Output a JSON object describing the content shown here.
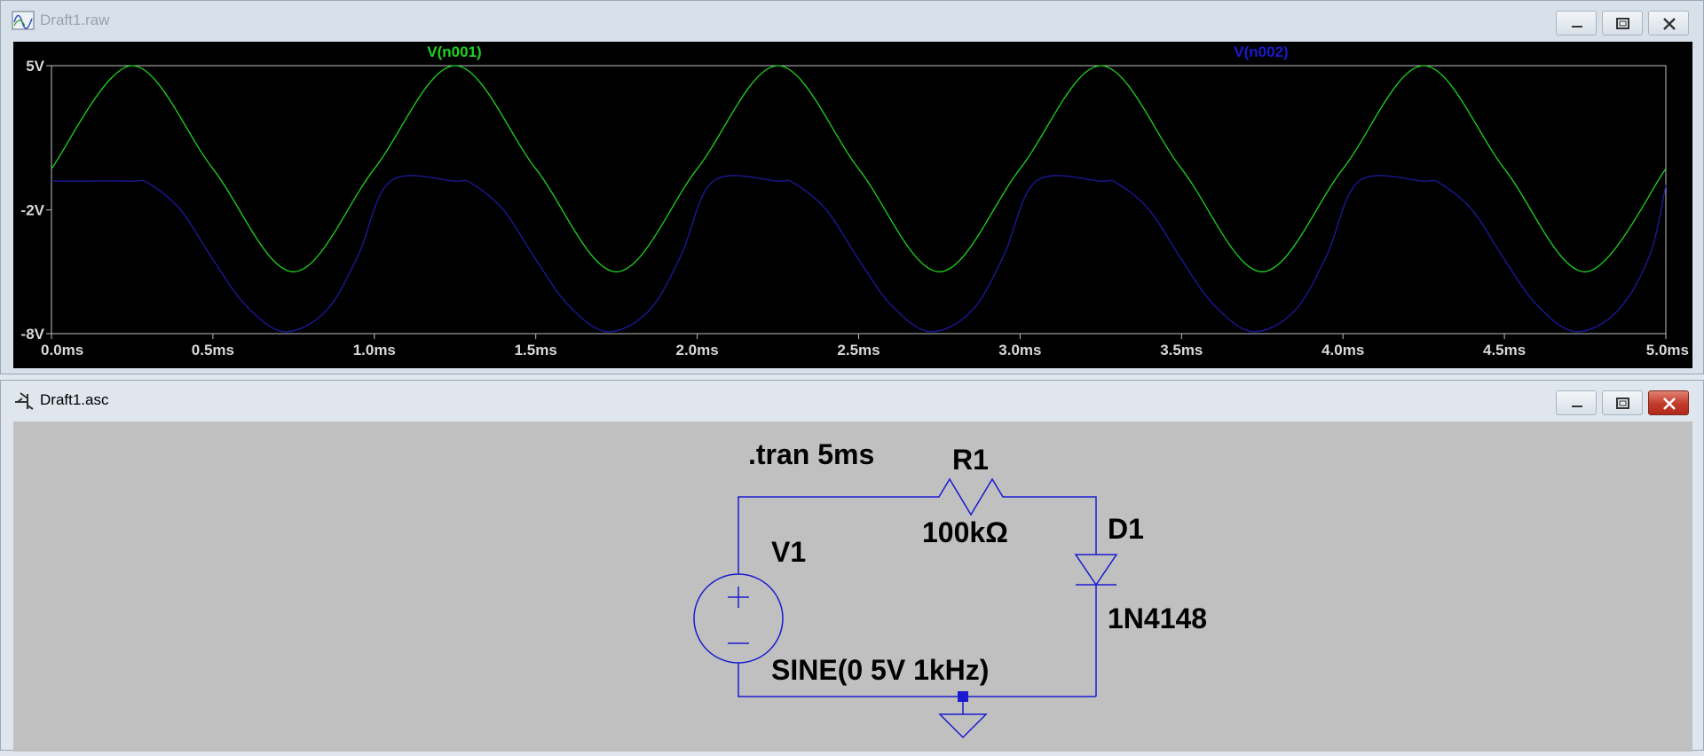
{
  "waveform_window": {
    "title": "Draft1.raw",
    "trace_labels": {
      "v_n001": "V(n001)",
      "v_n002": "V(n002)"
    },
    "y_ticks": [
      "5V",
      "-2V",
      "-8V"
    ],
    "x_ticks": [
      "0.0ms",
      "0.5ms",
      "1.0ms",
      "1.5ms",
      "2.0ms",
      "2.5ms",
      "3.0ms",
      "3.5ms",
      "4.0ms",
      "4.5ms",
      "5.0ms"
    ]
  },
  "schematic_window": {
    "title": "Draft1.asc",
    "directive": ".tran 5ms",
    "r1": {
      "name": "R1",
      "value": "100kΩ"
    },
    "v1": {
      "name": "V1",
      "value": "SINE(0 5V 1kHz)"
    },
    "d1": {
      "name": "D1",
      "value": "1N4148"
    }
  },
  "colors": {
    "v_n001": "#1ed21e",
    "v_n002": "#1a1aa0",
    "wire": "#1a1ad0",
    "plot_bg": "#000000",
    "schematic_bg": "#c0c0c0"
  },
  "chart_data": {
    "type": "line",
    "xlabel": "",
    "ylabel": "",
    "x_unit": "ms",
    "xlim": [
      0,
      5
    ],
    "ylim": [
      -8,
      5
    ],
    "x_ticks": [
      "0.0ms",
      "0.5ms",
      "1.0ms",
      "1.5ms",
      "2.0ms",
      "2.5ms",
      "3.0ms",
      "3.5ms",
      "4.0ms",
      "4.5ms",
      "5.0ms"
    ],
    "y_ticks": [
      "5V",
      "-2V",
      "-8V"
    ],
    "grid": false,
    "series": [
      {
        "name": "V(n001)",
        "color": "#1ed21e",
        "x": [
          0,
          0.25,
          0.5,
          0.75,
          1.0,
          1.25,
          1.5,
          1.75,
          2.0,
          2.25,
          2.5,
          2.75,
          3.0,
          3.25,
          3.5,
          3.75,
          4.0,
          4.25,
          4.5,
          4.75,
          5.0
        ],
        "y": [
          0,
          5,
          0,
          -5,
          0,
          5,
          0,
          -5,
          0,
          5,
          0,
          -5,
          0,
          5,
          0,
          -5,
          0,
          5,
          0,
          -5,
          0
        ]
      },
      {
        "name": "V(n002)",
        "color": "#1a1aa0",
        "x": [
          0,
          0.1,
          0.25,
          0.3,
          0.4,
          0.5,
          0.6,
          0.72,
          0.85,
          0.95,
          1.05,
          1.25,
          1.3,
          1.4,
          1.5,
          1.6,
          1.72,
          1.85,
          1.95,
          2.05,
          2.25,
          2.3,
          2.4,
          2.5,
          2.6,
          2.72,
          2.85,
          2.95,
          3.05,
          3.25,
          3.3,
          3.4,
          3.5,
          3.6,
          3.72,
          3.85,
          3.95,
          4.05,
          4.25,
          4.3,
          4.4,
          4.5,
          4.6,
          4.72,
          4.85,
          4.95,
          5.0
        ],
        "y": [
          -0.6,
          -0.6,
          -0.6,
          -0.7,
          -2.0,
          -4.4,
          -6.6,
          -7.9,
          -6.9,
          -4.2,
          -0.6,
          -0.6,
          -0.7,
          -2.0,
          -4.4,
          -6.6,
          -7.9,
          -6.9,
          -4.2,
          -0.6,
          -0.6,
          -0.7,
          -2.0,
          -4.4,
          -6.6,
          -7.9,
          -6.9,
          -4.2,
          -0.6,
          -0.6,
          -0.7,
          -2.0,
          -4.4,
          -6.6,
          -7.9,
          -6.9,
          -4.2,
          -0.6,
          -0.6,
          -0.7,
          -2.0,
          -4.4,
          -6.6,
          -7.9,
          -6.9,
          -4.2,
          -0.8
        ]
      }
    ]
  }
}
